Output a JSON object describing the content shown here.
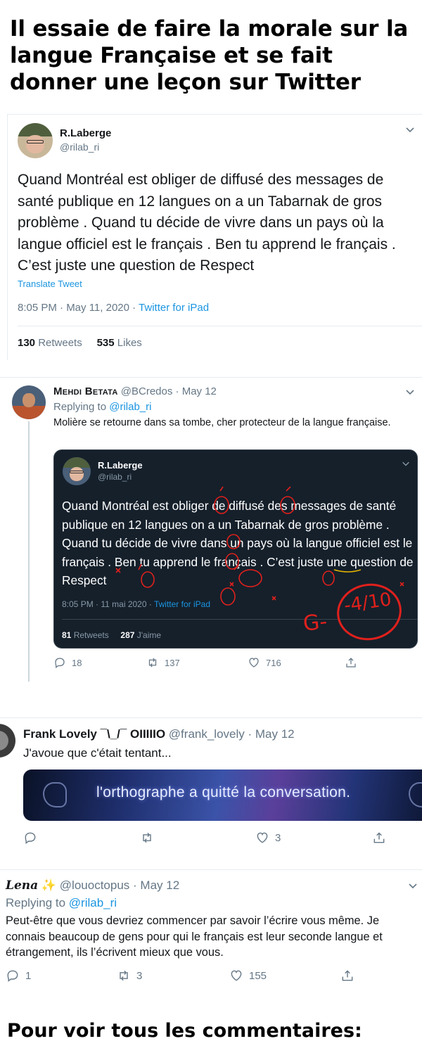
{
  "headline": "Il essaie de faire la morale sur la langue Française et se fait donner une leçon sur Twitter",
  "tweet1": {
    "name": "R.Laberge",
    "handle": "@rilab_ri",
    "body": "Quand Montréal est obliger de diffusé des messages de santé publique en 12 langues on a un Tabarnak de gros problème . Quand tu décide de vivre dans un pays où la langue officiel est le français . Ben tu apprend le français . C’est juste une question de Respect",
    "translate": "Translate Tweet",
    "time": "8:05 PM · May 11, 2020 · ",
    "source": "Twitter for iPad",
    "retweets": "130",
    "retweets_label": " Retweets",
    "likes": "535",
    "likes_label": " Likes"
  },
  "tweet2": {
    "name": "Mehdi Betata",
    "handle": "@BCredos",
    "date": "· May 12",
    "replying_prefix": "Replying to ",
    "replying_to": "@rilab_ri",
    "body": "Molière se retourne dans sa tombe, cher protecteur de la langue française.",
    "quote": {
      "name": "R.Laberge",
      "handle": "@rilab_ri",
      "body": "Quand Montréal est obliger de diffusé des messages de santé publique en 12 langues on a un Tabarnak de gros problème . Quand tu décide de vivre dans un pays où la langue officiel est le français . Ben tu apprend le français . C’est juste une question de Respect",
      "time": "8:05 PM · 11 mai 2020 · ",
      "source": "Twitter for iPad",
      "retweets": "81",
      "retweets_label": " Retweets",
      "likes": "287",
      "likes_label": " J'aime",
      "grade": "G-",
      "score": "-4/10"
    },
    "replies": "18",
    "retweets": "137",
    "likes": "716"
  },
  "tweet3": {
    "name": "Frank Lovely ¯\\_/¯ OIIIIIO",
    "handle": "@frank_lovely",
    "date": "· May 12",
    "body": "J'avoue que c'était tentant...",
    "banner_text": "l'orthographe a quitté la conversation.",
    "likes": "3"
  },
  "tweet4": {
    "name": "Lena",
    "sparkle": "✨",
    "handle": "@louoctopus",
    "date": "· May 12",
    "replying_prefix": "Replying to ",
    "replying_to": "@rilab_ri",
    "body": "Peut-être que vous devriez commencer par savoir l’écrire vous même. Je connais beaucoup de gens pour qui le français est leur seconde langue et étrangement, ils l’écrivent mieux que vous.",
    "replies": "1",
    "retweets": "3",
    "likes": "155"
  },
  "footer": "Pour voir tous les commentaires:",
  "colors": {
    "link": "#1b95e0",
    "muted": "#657786",
    "dark_card": "#15202b",
    "correction_red": "#e0201c"
  },
  "icons": [
    "chevron-down-icon",
    "reply-icon",
    "retweet-icon",
    "like-icon",
    "share-icon"
  ]
}
